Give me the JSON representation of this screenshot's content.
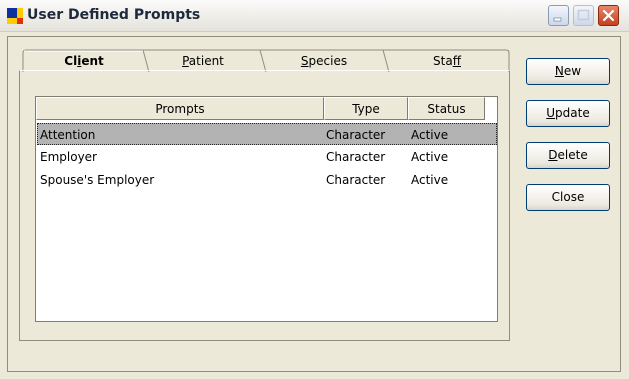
{
  "window": {
    "title": "User Defined Prompts"
  },
  "tabs": [
    {
      "label": "Client",
      "mnemonic": "i",
      "active": true
    },
    {
      "label": "Patient",
      "mnemonic": "P",
      "active": false
    },
    {
      "label": "Species",
      "mnemonic": "S",
      "active": false
    },
    {
      "label": "Staff",
      "mnemonic": "f",
      "active": false
    }
  ],
  "grid": {
    "columns": [
      "Prompts",
      "Type",
      "Status"
    ],
    "rows": [
      {
        "prompt": "Attention",
        "type": "Character",
        "status": "Active",
        "selected": true
      },
      {
        "prompt": "Employer",
        "type": "Character",
        "status": "Active",
        "selected": false
      },
      {
        "prompt": "Spouse's Employer",
        "type": "Character",
        "status": "Active",
        "selected": false
      }
    ]
  },
  "buttons": {
    "new": {
      "label": "New",
      "mnemonic": "N"
    },
    "update": {
      "label": "Update",
      "mnemonic": "U"
    },
    "delete": {
      "label": "Delete",
      "mnemonic": "D"
    },
    "close": {
      "label": "Close",
      "mnemonic": ""
    }
  },
  "colors": {
    "window_bg": "#ece9d8",
    "selection_bg": "#b3b3b3",
    "close_button": "#c3401f"
  }
}
